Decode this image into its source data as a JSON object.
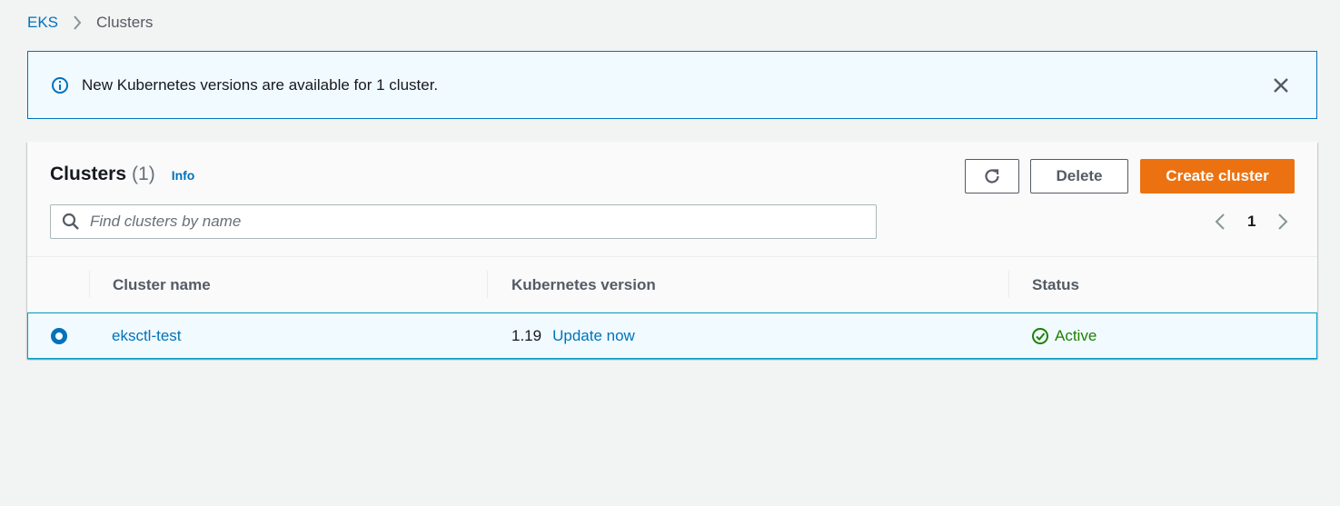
{
  "breadcrumb": {
    "root": "EKS",
    "current": "Clusters"
  },
  "flash": {
    "message": "New Kubernetes versions are available for 1 cluster.",
    "icon": "info-icon",
    "close_icon": "close-icon"
  },
  "panel": {
    "title": "Clusters",
    "count": "(1)",
    "info_link": "Info",
    "refresh_icon": "refresh-icon",
    "delete_label": "Delete",
    "create_label": "Create cluster",
    "search_placeholder": "Find clusters by name",
    "search_value": "",
    "pagination": {
      "current_page": "1"
    }
  },
  "table": {
    "columns": [
      "Cluster name",
      "Kubernetes version",
      "Status"
    ],
    "rows": [
      {
        "selected": true,
        "name": "eksctl-test",
        "version": "1.19",
        "update_link": "Update now",
        "status": "Active"
      }
    ]
  },
  "colors": {
    "accent": "#0073bb",
    "primary_button": "#ec7211",
    "success": "#1d8102",
    "flash_bg": "#f1faff"
  }
}
